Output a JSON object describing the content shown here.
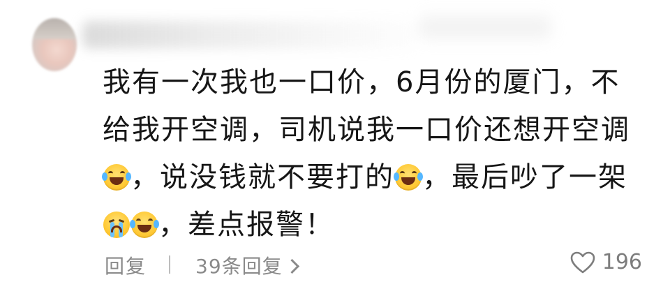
{
  "comment": {
    "lines": [
      "我有一次我也一口价，6月份的厦门，不",
      "给我开空调，司机说我一口价还想开空调",
      [
        "，说没钱就不要打的",
        "，最后吵了一架"
      ],
      "，差点报警！"
    ],
    "segments": {
      "line3_part1": "，说没钱就不要打的",
      "line3_part2": "，最后吵了一架",
      "line4": "，差点报警！"
    }
  },
  "footer": {
    "reply_label": "回复",
    "reply_count_label": "39条回复",
    "like_count": "196"
  },
  "icons": {
    "emoji_laugh": "laugh-tears-emoji-icon",
    "emoji_cry": "crying-emoji-icon",
    "heart": "heart-outline-icon",
    "chevron": "chevron-right-icon"
  },
  "colors": {
    "text": "#161616",
    "muted": "#8a8a8a",
    "emoji_yellow": "#ffc935"
  }
}
